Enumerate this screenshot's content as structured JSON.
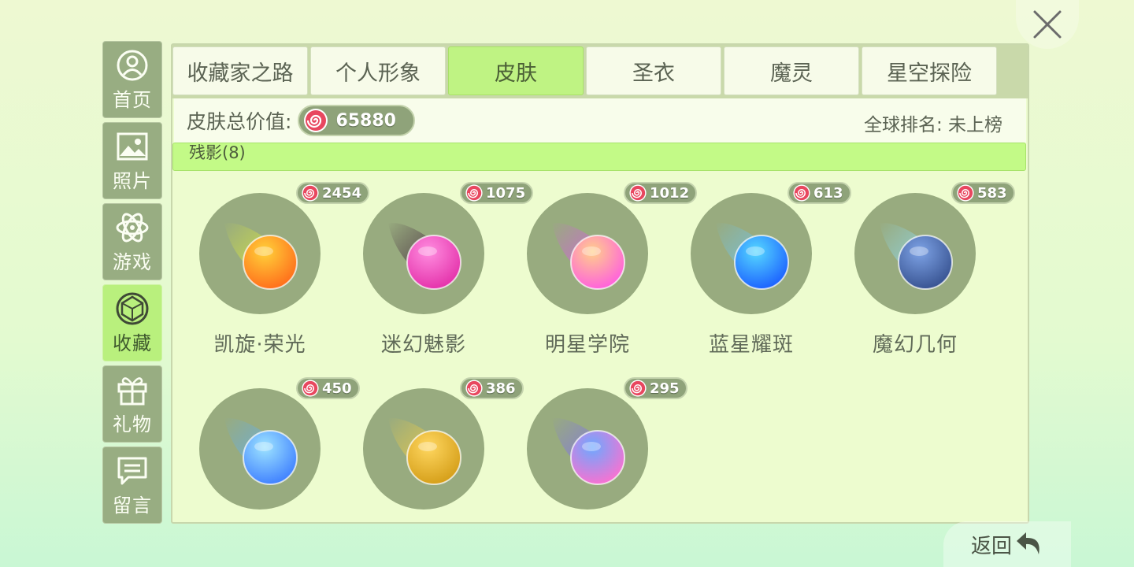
{
  "sidebar": {
    "items": [
      {
        "label": "首页",
        "icon": "home-avatar-icon",
        "active": false
      },
      {
        "label": "照片",
        "icon": "photo-icon",
        "active": false
      },
      {
        "label": "游戏",
        "icon": "atom-icon",
        "active": false
      },
      {
        "label": "收藏",
        "icon": "gem-icon",
        "active": true
      },
      {
        "label": "礼物",
        "icon": "gift-icon",
        "active": false
      },
      {
        "label": "留言",
        "icon": "message-icon",
        "active": false
      }
    ]
  },
  "tabs": [
    {
      "label": "收藏家之路",
      "active": false
    },
    {
      "label": "个人形象",
      "active": false
    },
    {
      "label": "皮肤",
      "active": true
    },
    {
      "label": "圣衣",
      "active": false
    },
    {
      "label": "魔灵",
      "active": false
    },
    {
      "label": "星空探险",
      "active": false
    }
  ],
  "summary": {
    "value_label": "皮肤总价值:",
    "total_value": "65880",
    "rank_text": "全球排名: 未上榜"
  },
  "section": {
    "title": "残影(8)"
  },
  "items": [
    {
      "name": "凯旋·荣光",
      "value": "2454",
      "colors": [
        "#ffd23a",
        "#ff6a1a",
        "#e2ef33"
      ]
    },
    {
      "name": "迷幻魅影",
      "value": "1075",
      "colors": [
        "#ff8de0",
        "#e32ea8",
        "#3a1935"
      ]
    },
    {
      "name": "明星学院",
      "value": "1012",
      "colors": [
        "#ffd08a",
        "#ff5ce0",
        "#e050f0"
      ]
    },
    {
      "name": "蓝星耀斑",
      "value": "613",
      "colors": [
        "#56d9ff",
        "#1a5dff",
        "#6ac8ff"
      ]
    },
    {
      "name": "魔幻几何",
      "value": "583",
      "colors": [
        "#7ea3e6",
        "#35508e",
        "#8ee0ff"
      ]
    },
    {
      "name": "",
      "value": "450",
      "colors": [
        "#9ee4ff",
        "#3c7dff",
        "#5ab0ff"
      ]
    },
    {
      "name": "",
      "value": "386",
      "colors": [
        "#ffd760",
        "#d39c16",
        "#ffd23a"
      ]
    },
    {
      "name": "",
      "value": "295",
      "colors": [
        "#6ba9ff",
        "#ff6fcf",
        "#7b67ff"
      ]
    }
  ],
  "footer": {
    "back_label": "返回"
  }
}
